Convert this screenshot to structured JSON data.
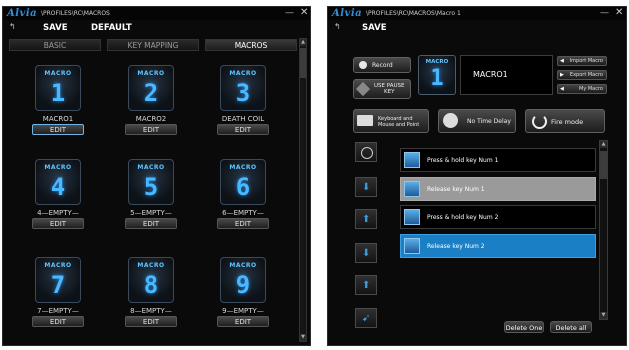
{
  "left_window": {
    "logo": "Alvia",
    "path": "\\PROFILES\\RC\\MACROS",
    "min": "—",
    "close": "✕",
    "back": "↰",
    "menu": {
      "save": "SAVE",
      "default": "DEFAULT"
    },
    "tabs": [
      "BASIC",
      "KEY MAPPING",
      "MACROS"
    ],
    "edit_label": "EDIT",
    "macros": [
      {
        "tile": "MACRO",
        "num": "1",
        "name": "MACRO1"
      },
      {
        "tile": "MACRO",
        "num": "2",
        "name": "MACRO2"
      },
      {
        "tile": "MACRO",
        "num": "3",
        "name": "DEATH COIL"
      },
      {
        "tile": "MACRO",
        "num": "4",
        "name": "4—EMPTY—"
      },
      {
        "tile": "MACRO",
        "num": "5",
        "name": "5—EMPTY—"
      },
      {
        "tile": "MACRO",
        "num": "6",
        "name": "6—EMPTY—"
      },
      {
        "tile": "MACRO",
        "num": "7",
        "name": "7—EMPTY—"
      },
      {
        "tile": "MACRO",
        "num": "8",
        "name": "8—EMPTY—"
      },
      {
        "tile": "MACRO",
        "num": "9",
        "name": "9—EMPTY—"
      }
    ]
  },
  "right_window": {
    "logo": "Alvia",
    "path": "\\PROFILES\\RC\\MACROS\\Macro 1",
    "min": "—",
    "close": "✕",
    "back": "↰",
    "menu": {
      "save": "SAVE"
    },
    "record": "Record",
    "use_pause": "USE PAUSE\nKEY",
    "tile": {
      "label": "MACRO",
      "num": "1"
    },
    "macro_name": "MACRO1",
    "import": "Import Macro",
    "export": "Export Macro",
    "my_macro": "My Macro",
    "keyboard_mouse": "Keyboard and\nMouse and Point",
    "no_time_delay": "No Time Delay",
    "fire_mode": "Fire mode",
    "actions": [
      {
        "text": "Press & hold key Num 1",
        "style": "normal"
      },
      {
        "text": "Release key Num 1",
        "style": "gray"
      },
      {
        "text": "Press & hold key Num 2",
        "style": "normal"
      },
      {
        "text": "Release key Num 2",
        "style": "blue"
      }
    ],
    "delete_one": "Delete One",
    "delete_all": "Delete all"
  }
}
